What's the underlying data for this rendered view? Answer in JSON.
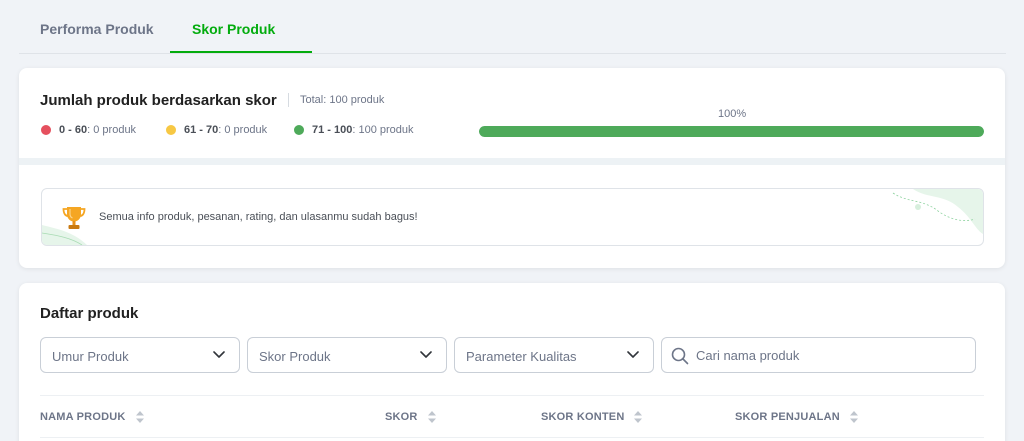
{
  "tabs": [
    {
      "label": "Performa Produk",
      "active": false
    },
    {
      "label": "Skor Produk",
      "active": true
    }
  ],
  "summary": {
    "title": "Jumlah produk berdasarkan skor",
    "total": "Total: 100 produk",
    "legend": [
      {
        "range": "0 - 60",
        "text": ": 0 produk",
        "color": "#e5505e"
      },
      {
        "range": "61 - 70",
        "text": ": 0 produk",
        "color": "#f7c844"
      },
      {
        "range": "71 - 100",
        "text": ": 100 produk",
        "color": "#4eaa5a"
      }
    ],
    "progress_label": "100%",
    "progress_value": 1.0
  },
  "banner": {
    "text": "Semua info produk, pesanan, rating, dan ulasanmu sudah bagus!",
    "icon": "trophy-icon"
  },
  "product_list": {
    "title": "Daftar produk",
    "filters": [
      "Umur Produk",
      "Skor Produk",
      "Parameter Kualitas"
    ],
    "search_placeholder": "Cari nama produk",
    "columns": [
      "NAMA PRODUK",
      "SKOR",
      "SKOR KONTEN",
      "SKOR PENJUALAN"
    ]
  },
  "colors": {
    "accent": "#03ac0e",
    "progress": "#4eaa5a"
  }
}
